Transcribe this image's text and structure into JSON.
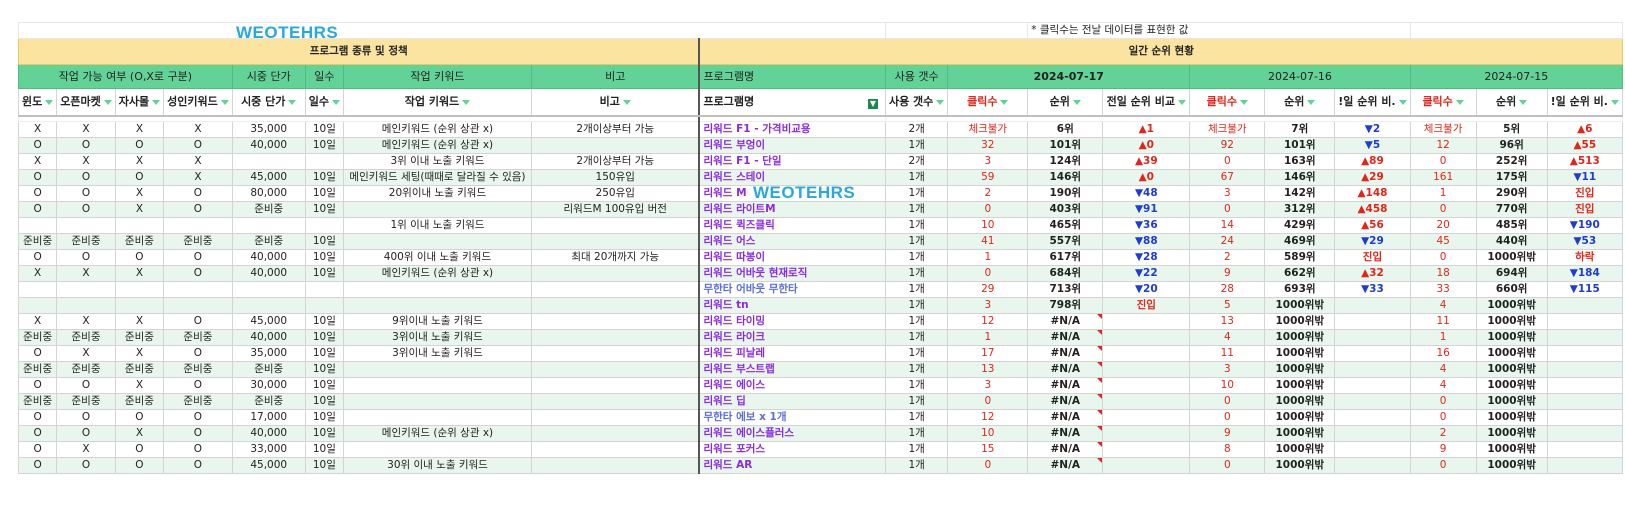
{
  "watermark": "WEOTEHRS",
  "note": "* 클릭수는 전날 데이터를 표현한 값",
  "titles": {
    "left": "프로그램 종류 및 정책",
    "right": "일간 순위 현황"
  },
  "group_headers": [
    "작업 가능 여부 (O,X로 구분)",
    "시중 단가",
    "일수",
    "작업 키워드",
    "비고",
    "프로그램명",
    "사용 갯수",
    "2024-07-17",
    "2024-07-16",
    "2024-07-15"
  ],
  "filter_headers": [
    "윈도",
    "오픈마켓",
    "자사몰",
    "성인키워드",
    "시중 단가",
    "일수",
    "작업 키워드",
    "비고",
    "프로그램명",
    "사용 갯수",
    "클릭수",
    "순위",
    "전일 순위 비교",
    "클릭수",
    "순위",
    "!일 순위 비.",
    "클릭수",
    "순위",
    "!일 순위 비."
  ],
  "rows": [
    [
      "X",
      "X",
      "X",
      "X",
      "35,000",
      "10일",
      "메인키워드 (순위 상관 x)",
      "2개이상부터 가능",
      "리워드 F1 - 가격비교용",
      "2개",
      "체크불가",
      "6위",
      "▲1",
      "체크불가",
      "7위",
      "▼2",
      "체크불가",
      "5위",
      "▲6"
    ],
    [
      "O",
      "O",
      "O",
      "O",
      "40,000",
      "10일",
      "메인키워드 (순위 상관 x)",
      "",
      "리워드 부엉이",
      "1개",
      "32",
      "101위",
      "▲0",
      "92",
      "101위",
      "▼5",
      "12",
      "96위",
      "▲55"
    ],
    [
      "X",
      "X",
      "X",
      "X",
      "",
      "",
      "3위 이내 노출 키워드",
      "2개이상부터 가능",
      "리워드 F1 - 단일",
      "2개",
      "3",
      "124위",
      "▲39",
      "0",
      "163위",
      "▲89",
      "0",
      "252위",
      "▲513"
    ],
    [
      "O",
      "O",
      "O",
      "X",
      "45,000",
      "10일",
      "메인키워드 세팅(때때로 달라질 수 있음)",
      "150유입",
      "리워드 스테이",
      "1개",
      "59",
      "146위",
      "▲0",
      "67",
      "146위",
      "▲29",
      "161",
      "175위",
      "▼11"
    ],
    [
      "O",
      "O",
      "X",
      "O",
      "80,000",
      "10일",
      "20위이내 노출 키워드",
      "250유입",
      "리워드 M",
      "1개",
      "2",
      "190위",
      "▼48",
      "3",
      "142위",
      "▲148",
      "1",
      "290위",
      "진입"
    ],
    [
      "O",
      "O",
      "X",
      "O",
      "준비중",
      "10일",
      "",
      "리워드M 100유입 버전",
      "리워드 라이트M",
      "1개",
      "0",
      "403위",
      "▼91",
      "0",
      "312위",
      "▲458",
      "0",
      "770위",
      "진입"
    ],
    [
      "",
      "",
      "",
      "",
      "",
      "",
      "1위 이내 노출 키워드",
      "",
      "리워드 퀵즈클릭",
      "1개",
      "10",
      "465위",
      "▼36",
      "14",
      "429위",
      "▲56",
      "20",
      "485위",
      "▼190"
    ],
    [
      "준비중",
      "준비중",
      "준비중",
      "준비중",
      "준비중",
      "10일",
      "",
      "",
      "리워드 어스",
      "1개",
      "41",
      "557위",
      "▼88",
      "24",
      "469위",
      "▼29",
      "45",
      "440위",
      "▼53"
    ],
    [
      "O",
      "O",
      "O",
      "O",
      "40,000",
      "10일",
      "400위 이내 노출 키워드",
      "최대 20개까지 가능",
      "리워드 따봉이",
      "1개",
      "1",
      "617위",
      "▼28",
      "2",
      "589위",
      "진입",
      "0",
      "1000위밖",
      "하락"
    ],
    [
      "X",
      "X",
      "X",
      "O",
      "40,000",
      "10일",
      "메인키워드 (순위 상관 x)",
      "",
      "리워드 어바웃 현재로직",
      "1개",
      "0",
      "684위",
      "▼22",
      "9",
      "662위",
      "▲32",
      "18",
      "694위",
      "▼184"
    ],
    [
      "",
      "",
      "",
      "",
      "",
      "",
      "",
      "",
      "무한타 어바웃 무한타",
      "1개",
      "29",
      "713위",
      "▼20",
      "28",
      "693위",
      "▼33",
      "33",
      "660위",
      "▼115"
    ],
    [
      "",
      "",
      "",
      "",
      "",
      "",
      "",
      "",
      "리워드 tn",
      "1개",
      "3",
      "798위",
      "진입",
      "5",
      "1000위밖",
      "",
      "4",
      "1000위밖",
      ""
    ],
    [
      "X",
      "X",
      "X",
      "O",
      "45,000",
      "10일",
      "9위이내 노출 키워드",
      "",
      "리워드 타이밍",
      "1개",
      "12",
      "#N/A",
      "",
      "13",
      "1000위밖",
      "",
      "11",
      "1000위밖",
      ""
    ],
    [
      "준비중",
      "준비중",
      "준비중",
      "준비중",
      "40,000",
      "10일",
      "3위이내 노출 키워드",
      "",
      "리워드 라이크",
      "1개",
      "1",
      "#N/A",
      "",
      "4",
      "1000위밖",
      "",
      "1",
      "1000위밖",
      ""
    ],
    [
      "O",
      "X",
      "X",
      "O",
      "35,000",
      "10일",
      "3위이내 노출 키워드",
      "",
      "리워드 피날레",
      "1개",
      "17",
      "#N/A",
      "",
      "11",
      "1000위밖",
      "",
      "16",
      "1000위밖",
      ""
    ],
    [
      "준비중",
      "준비중",
      "준비중",
      "준비중",
      "준비중",
      "10일",
      "",
      "",
      "리워드 부스트랩",
      "1개",
      "13",
      "#N/A",
      "",
      "3",
      "1000위밖",
      "",
      "4",
      "1000위밖",
      ""
    ],
    [
      "O",
      "O",
      "X",
      "O",
      "30,000",
      "10일",
      "",
      "",
      "리워드 에이스",
      "1개",
      "3",
      "#N/A",
      "",
      "10",
      "1000위밖",
      "",
      "4",
      "1000위밖",
      ""
    ],
    [
      "준비중",
      "준비중",
      "준비중",
      "준비중",
      "준비중",
      "10일",
      "",
      "",
      "리워드 딥",
      "1개",
      "0",
      "#N/A",
      "",
      "0",
      "1000위밖",
      "",
      "0",
      "1000위밖",
      ""
    ],
    [
      "O",
      "O",
      "O",
      "O",
      "17,000",
      "10일",
      "",
      "",
      "무한타 에보 x 1개",
      "1개",
      "12",
      "#N/A",
      "",
      "0",
      "1000위밖",
      "",
      "0",
      "1000위밖",
      ""
    ],
    [
      "O",
      "O",
      "X",
      "O",
      "40,000",
      "10일",
      "메인키워드 (순위 상관 x)",
      "",
      "리워드 에이스플러스",
      "1개",
      "10",
      "#N/A",
      "",
      "9",
      "1000위밖",
      "",
      "2",
      "1000위밖",
      ""
    ],
    [
      "O",
      "X",
      "O",
      "O",
      "33,000",
      "10일",
      "",
      "",
      "리워드 포커스",
      "1개",
      "15",
      "#N/A",
      "",
      "8",
      "1000위밖",
      "",
      "9",
      "1000위밖",
      ""
    ],
    [
      "O",
      "O",
      "O",
      "O",
      "45,000",
      "10일",
      "30위 이내 노출 키워드",
      "",
      "리워드 AR",
      "1개",
      "0",
      "#N/A",
      "",
      "0",
      "1000위밖",
      "",
      "0",
      "1000위밖",
      ""
    ]
  ]
}
